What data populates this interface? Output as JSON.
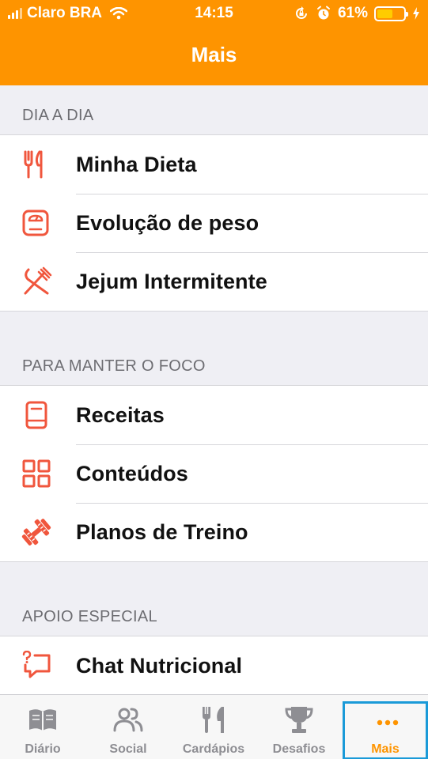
{
  "status_bar": {
    "carrier": "Claro BRA",
    "time": "14:15",
    "battery": "61%"
  },
  "nav": {
    "title": "Mais"
  },
  "sections": [
    {
      "header": "DIA A DIA",
      "items": [
        {
          "label": "Minha Dieta",
          "icon": "fork-knife-icon"
        },
        {
          "label": "Evolução de peso",
          "icon": "scale-icon"
        },
        {
          "label": "Jejum Intermitente",
          "icon": "crossed-utensils-icon"
        }
      ]
    },
    {
      "header": "PARA MANTER O FOCO",
      "items": [
        {
          "label": "Receitas",
          "icon": "book-icon"
        },
        {
          "label": "Conteúdos",
          "icon": "grid-icon"
        },
        {
          "label": "Planos de Treino",
          "icon": "dumbbell-icon"
        }
      ]
    },
    {
      "header": "APOIO ESPECIAL",
      "items": [
        {
          "label": "Chat Nutricional",
          "icon": "chat-question-icon"
        }
      ]
    }
  ],
  "tabs": [
    {
      "label": "Diário",
      "icon": "book-icon"
    },
    {
      "label": "Social",
      "icon": "people-icon"
    },
    {
      "label": "Cardápios",
      "icon": "fork-knife-icon"
    },
    {
      "label": "Desafios",
      "icon": "trophy-icon"
    },
    {
      "label": "Mais",
      "icon": "more-dots-icon",
      "active": true
    }
  ],
  "colors": {
    "accent": "#fe9400",
    "icon_red": "#f0563d",
    "tab_inactive": "#8e8e93",
    "highlight_border": "#1a9ad8"
  }
}
